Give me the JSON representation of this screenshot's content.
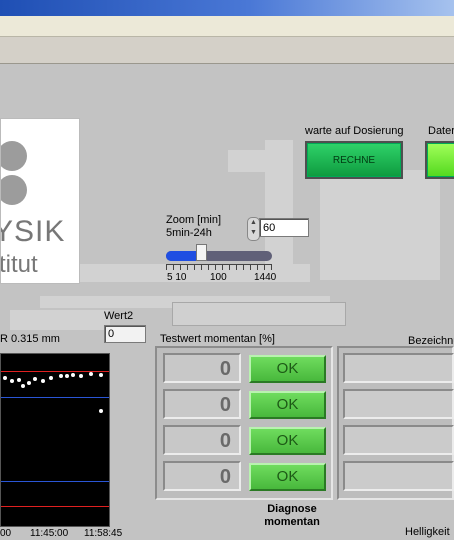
{
  "panel": {
    "status_label": "warte auf Dosierung",
    "rechne_led": "RECHNE",
    "daten_label": "Dater",
    "zoom_label": "Zoom [min]",
    "zoom_range": "5min-24h",
    "zoom_value": "60",
    "slider_ticks": [
      "5 10",
      "100",
      "1440"
    ],
    "slider_fraction": 0.33,
    "logo_text_1": "YSIK",
    "logo_text_2": "titut",
    "wert2_label": "Wert2",
    "wert2_value": "0",
    "r_label": "R 0.315 mm",
    "testwert_label": "Testwert momentan [%]",
    "bezeichnung_label": "Bezeichnu",
    "rows": [
      {
        "value": "0",
        "status": "OK"
      },
      {
        "value": "0",
        "status": "OK"
      },
      {
        "value": "0",
        "status": "OK"
      },
      {
        "value": "0",
        "status": "OK"
      }
    ],
    "diagnose_label": "Diagnose momentan",
    "helligkeit_label": "Helligkeit",
    "time_ticks": [
      "00",
      "11:45:00",
      "11:58:45"
    ]
  },
  "colors": {
    "led_green": "#16b24a",
    "ok_green": "#58c84a",
    "red_line": "#e02020",
    "blue_line": "#2a56d6"
  }
}
